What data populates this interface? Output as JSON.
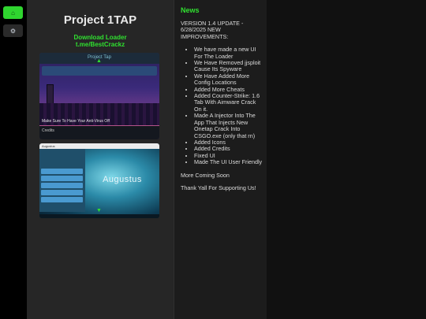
{
  "sidebar": {
    "home_icon": "home-icon",
    "settings_icon": "settings-icon",
    "accent": "#2fd52f"
  },
  "left": {
    "title": "Project 1TAP",
    "download": {
      "line1": "Download Loader",
      "line2": "t.me/BestCrackz",
      "color": "#30e030"
    },
    "screenshots": {
      "first": {
        "title": "Project Tap",
        "caption": "Make Sure To Have Your Anti-Virus Off",
        "credits": "Credits"
      },
      "second": {
        "window_title": "Augustus",
        "brand": "Augustus"
      }
    }
  },
  "news": {
    "heading": "News",
    "intro": "VERSION 1.4 UPDATE - 6/28/2025 NEW IMPROVEMENTS:",
    "items": [
      "We have made a new UI For The Loader",
      "We Have Removed jjsploit Cause Its Spyware",
      "We Have Added More Config Locations",
      "Added More Cheats",
      "Added Counter-Strike: 1.6 Tab With Aimware Crack On it.",
      "Made A Injector Into The App That Injects New Onetap Crack Into CSGO.exe (only that rn)",
      "Added Icons",
      "Added Credits",
      "Fixed UI",
      "Made The UI User Friendly"
    ],
    "more": "More Coming Soon",
    "thanks": "Thank Yall For Supporting Us!"
  }
}
